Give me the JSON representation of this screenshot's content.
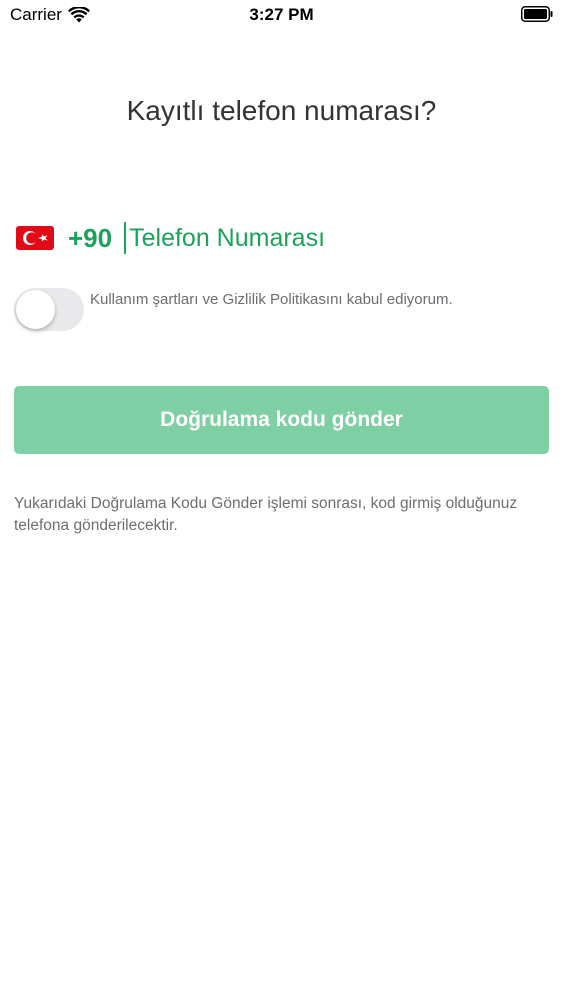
{
  "status_bar": {
    "carrier": "Carrier",
    "time": "3:27 PM",
    "icons": [
      "wifi-icon",
      "battery-icon"
    ]
  },
  "page": {
    "title": "Kayıtlı telefon numarası?"
  },
  "phone": {
    "flag_icon": "turkey-flag-icon",
    "country_code": "+90",
    "placeholder": "Telefon Numarası",
    "value": ""
  },
  "terms": {
    "toggle_on": false,
    "label": "Kullanım şartları ve Gizlilik Politikasını kabul ediyorum."
  },
  "send_button": {
    "label": "Doğrulama kodu gönder"
  },
  "info": {
    "text": "Yukarıdaki Doğrulama Kodu Gönder işlemi sonrası, kod girmiş olduğunuz telefona gönderilecektir."
  },
  "colors": {
    "accent": "#1aa35a",
    "button_bg": "#7fcfa4",
    "toggle_off": "#e9e9eb",
    "muted_text": "#6d6d72",
    "title_text": "#333333"
  }
}
